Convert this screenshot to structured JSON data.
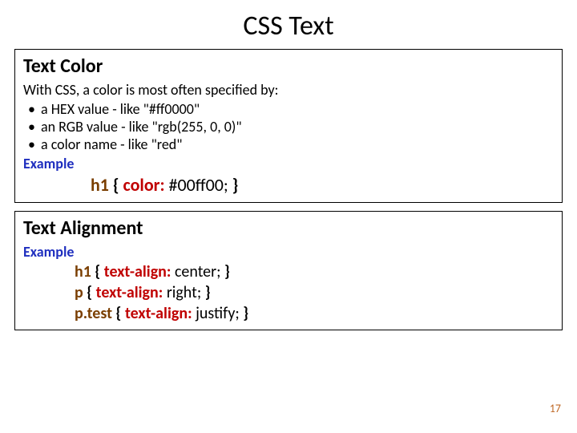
{
  "title": "CSS Text",
  "box1": {
    "heading": "Text Color",
    "intro": "With CSS, a color is most often specified by:",
    "bullets": [
      "a HEX value - like \"#ff0000\"",
      "an RGB value - like \"rgb(255, 0, 0)\"",
      "a color name - like \"red\""
    ],
    "example_label": "Example",
    "code1": {
      "selector": "h1",
      "open": " { ",
      "prop": "color:",
      "value": " #00ff00; ",
      "close": "}"
    }
  },
  "box2": {
    "heading": "Text Alignment",
    "example_label": "Example",
    "lines": [
      {
        "selector": "h1",
        "open": " { ",
        "prop": "text-align:",
        "value": " center; ",
        "close": "}"
      },
      {
        "selector": "p",
        "open": " { ",
        "prop": "text-align:",
        "value": " right; ",
        "close": "}"
      },
      {
        "selector": "p.test",
        "open": " { ",
        "prop": "text-align:",
        "value": " justify; ",
        "close": "}"
      }
    ]
  },
  "page_number": "17"
}
